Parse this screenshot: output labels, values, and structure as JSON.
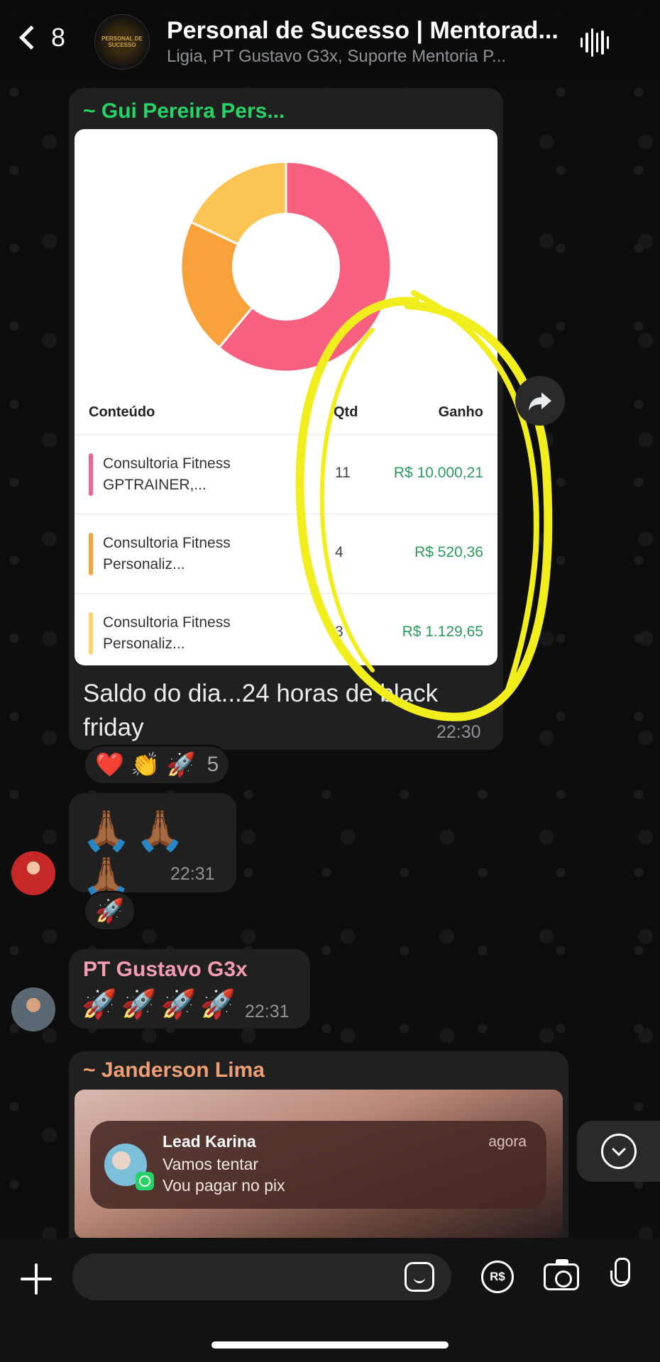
{
  "header": {
    "back_count": "8",
    "avatar_text": "PERSONAL DE SUCESSO",
    "title": "Personal de Sucesso | Mentorad...",
    "subtitle": "Ligia, PT Gustavo G3x, Suporte Mentoria P..."
  },
  "messages": [
    {
      "sender": "~ Gui Pereira Pers...",
      "card": {
        "donut": [
          {
            "value": 11,
            "share": 0.61,
            "color": "#f7607e"
          },
          {
            "value": 4,
            "share": 0.21,
            "color": "#f9a23b"
          },
          {
            "value": 3,
            "share": 0.18,
            "color": "#fcc553"
          }
        ],
        "headers": [
          "Conteúdo",
          "Qtd",
          "Ganho"
        ],
        "rows": [
          {
            "name": "Consultoria Fitness GPTRAINER,...",
            "qty": "11",
            "gain": "R$ 10.000,21",
            "color": "#f06292"
          },
          {
            "name": "Consultoria Fitness Personaliz...",
            "qty": "4",
            "gain": "R$ 520,36",
            "color": "#f9a23b"
          },
          {
            "name": "Consultoria Fitness Personaliz...",
            "qty": "3",
            "gain": "R$ 1.129,65",
            "color": "#fcd46b"
          }
        ]
      },
      "text": "Saldo do dia...24 horas de black friday",
      "time": "22:30",
      "reactions": "❤️ 👏 🚀",
      "reaction_count": "5"
    },
    {
      "content": "🙏🏾🙏🏾🙏🏾",
      "time": "22:31",
      "reactions": "🚀"
    },
    {
      "sender": "PT Gustavo G3x",
      "content": "🚀🚀🚀🚀",
      "time": "22:31"
    },
    {
      "sender": "~ Janderson Lima"
    }
  ],
  "notification": {
    "title": "Lead Karina",
    "time": "agora",
    "line1": "Vamos tentar",
    "line2": "Vou pagar no pix"
  },
  "composer": {
    "placeholder": "",
    "pix_label": "R$"
  },
  "colors": {
    "accent_green": "#25d366",
    "highlight_yellow": "#f2ee1d"
  }
}
